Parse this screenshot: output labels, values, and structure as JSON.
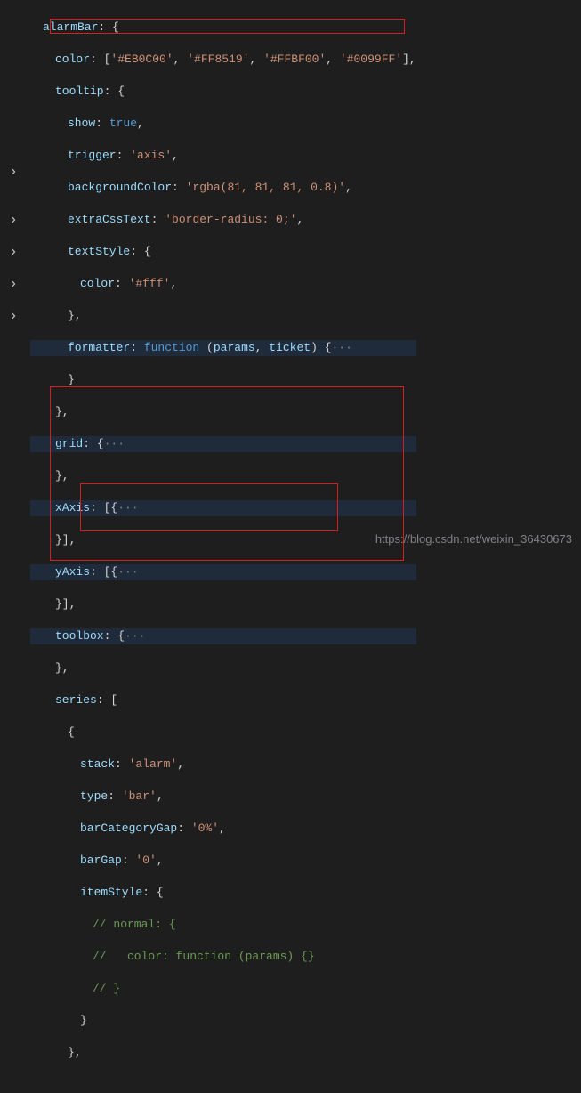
{
  "watermark": "https://blog.csdn.net/weixin_36430673",
  "colors": {
    "highlight_red": "#d02020"
  },
  "code": {
    "l1_prop": "alarmBar",
    "l1_rest": ": {",
    "l2_prop": "color",
    "l2_rest": ": [",
    "l2_c1": "'#EB0C00'",
    "l2_c2": "'#FF8519'",
    "l2_c3": "'#FFBF00'",
    "l2_c4": "'#0099FF'",
    "l2_end": "],",
    "l3_prop": "tooltip",
    "l3_rest": ": {",
    "l4_prop": "show",
    "l4_val": "true",
    "l5_prop": "trigger",
    "l5_val": "'axis'",
    "l6_prop": "backgroundColor",
    "l6_val": "'rgba(81, 81, 81, 0.8)'",
    "l7_prop": "extraCssText",
    "l7_val": "'border-radius: 0;'",
    "l8_prop": "textStyle",
    "l9_prop": "color",
    "l9_val": "'#fff'",
    "l10": "},",
    "l11_prop": "formatter",
    "l11_fn": "function",
    "l11_p1": "params",
    "l11_p2": "ticket",
    "l11_fold": "···",
    "l12": "}",
    "l13": "},",
    "l14_prop": "grid",
    "l14_fold": "···",
    "l15": "},",
    "l16_prop": "xAxis",
    "l16_fold": "···",
    "l17": "}],",
    "l18_prop": "yAxis",
    "l18_fold": "···",
    "l19": "}],",
    "l20_prop": "toolbox",
    "l20_fold": "···",
    "l21": "},",
    "l22_prop": "series",
    "l22_rest": ": [",
    "l23": "{",
    "l24_prop": "stack",
    "l24_val": "'alarm'",
    "l25_prop": "type",
    "l25_val": "'bar'",
    "l26_prop": "barCategoryGap",
    "l26_val": "'0%'",
    "l27_prop": "barGap",
    "l27_val": "'0'",
    "l28_prop": "itemStyle",
    "l29_c": "// normal: {",
    "l30_c": "//   color: function (params) {}",
    "l31_c": "// }",
    "l32": "}",
    "l33": "},"
  },
  "fold_rows": [
    11,
    14,
    16,
    18,
    20
  ]
}
